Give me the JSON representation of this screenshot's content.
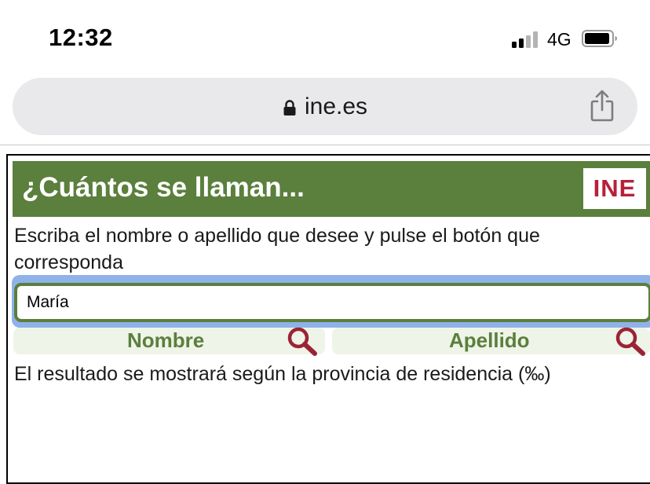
{
  "status_bar": {
    "time": "12:32",
    "network": "4G",
    "signal_bars_active": 2,
    "signal_bars_total": 4
  },
  "browser": {
    "url": "ine.es",
    "lock_icon": "lock-icon",
    "share_icon": "share-icon"
  },
  "page": {
    "title": "¿Cuántos se llaman...",
    "logo_text": "INE",
    "instructions": "Escriba el nombre o apellido que desee y pulse el botón que corresponda",
    "search_value": "María",
    "buttons": {
      "nombre": "Nombre",
      "apellido": "Apellido"
    },
    "result_note": "El resultado se mostrará según la provincia de residencia (‰)"
  },
  "colors": {
    "header_green": "#5b7f3c",
    "logo_red": "#b8203a",
    "focus_blue": "#8fb2ea",
    "button_bg": "#eef4e8",
    "magnifier": "#9b2335"
  }
}
